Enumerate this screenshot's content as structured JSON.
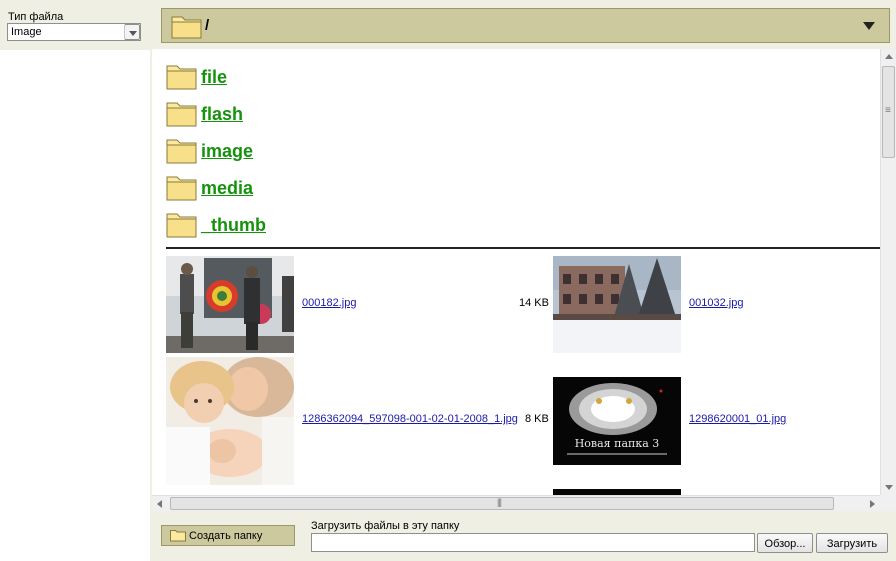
{
  "sidebar": {
    "type_label": "Тип файла",
    "type_value": "Image"
  },
  "path_bar": {
    "path": "/"
  },
  "folders": [
    {
      "name": "file"
    },
    {
      "name": "flash"
    },
    {
      "name": "image"
    },
    {
      "name": "media"
    },
    {
      "name": "_thumb"
    }
  ],
  "files": [
    {
      "name": "000182.jpg",
      "size": "14 KB"
    },
    {
      "name": "001032.jpg",
      "size": ""
    },
    {
      "name": "1286362094_597098-001-02-01-2008_1.jpg",
      "size": "8 KB"
    },
    {
      "name": "1298620001_01.jpg",
      "size": ""
    }
  ],
  "thumb_caption": {
    "line1": "Новая папка 3"
  },
  "bottom": {
    "create_folder": "Создать папку",
    "upload_label": "Загрузить файлы в эту папку",
    "browse": "Обзор...",
    "upload": "Загрузить"
  },
  "colors": {
    "panel": "#cdc99f",
    "folder_link": "#16920d",
    "file_link": "#1a1aa8"
  }
}
